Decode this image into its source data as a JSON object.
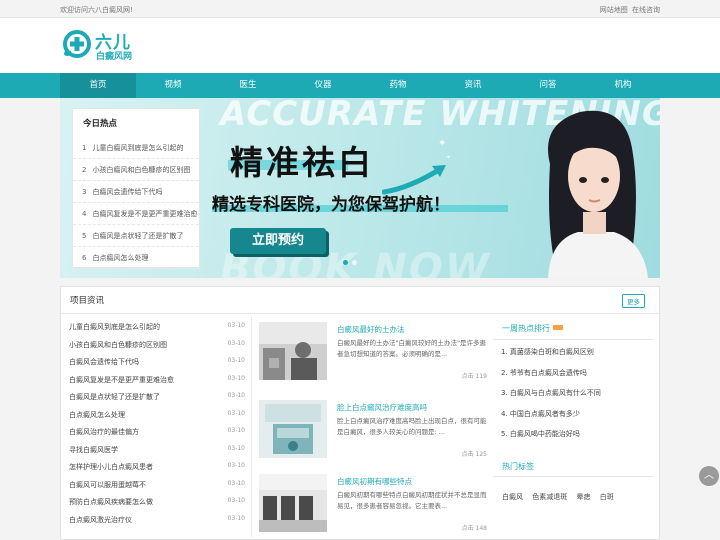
{
  "topbar": {
    "welcome": "欢迎访问六八白癜风网!",
    "links": [
      "网站地图",
      "在线咨询"
    ]
  },
  "logo": {
    "brand_main": "六儿",
    "brand_sub": "白癜风网"
  },
  "nav": {
    "items": [
      "首页",
      "视频",
      "医生",
      "仪器",
      "药物",
      "资讯",
      "问答",
      "机构"
    ],
    "active": "首页"
  },
  "banner": {
    "watermark_top": "ACCURATE WHITENING",
    "watermark_bottom": "BOOK NOW",
    "headline": "精准祛白",
    "subline": "精选专科医院，为您保驾护航！",
    "cta": "立即预约",
    "slide_count": 2,
    "active_slide": 1
  },
  "hot_today": {
    "title": "今日热点",
    "items": [
      "儿童白癜风到底是怎么引起的",
      "小孩白癜风和白色糠疹的区别图",
      "白癜风会遗传给下代吗",
      "白癜风复发是不是更严重更难治愈",
      "白癜风是点状轻了还是扩散了",
      "白点癜风怎么处理"
    ]
  },
  "section": {
    "title": "项目资讯",
    "more": "更多",
    "news": [
      {
        "title": "儿童白癜风到底是怎么引起的",
        "date": "03-10"
      },
      {
        "title": "小孩白癜风和白色糠疹的区别图",
        "date": "03-10"
      },
      {
        "title": "白癜风会遗传给下代吗",
        "date": "03-10"
      },
      {
        "title": "白癜风复发是不是更严重更难治愈",
        "date": "03-10"
      },
      {
        "title": "白癜风是点状轻了还是扩散了",
        "date": "03-10"
      },
      {
        "title": "白点癜风怎么处理",
        "date": "03-10"
      },
      {
        "title": "白癜风治疗的最佳偏方",
        "date": "03-10"
      },
      {
        "title": "寻找白癜风医学",
        "date": "03-10"
      },
      {
        "title": "怎样护理小儿白点癜风患者",
        "date": "03-10"
      },
      {
        "title": "白癜风可以服用蛋越莓不",
        "date": "03-10"
      },
      {
        "title": "预防白点癜风疾病要怎么做",
        "date": "03-10"
      },
      {
        "title": "白点癜风激光治疗仪",
        "date": "03-10"
      }
    ],
    "cards": [
      {
        "title": "白癜风最好的土办法",
        "desc": "白癜风最好的土办法\"白癜风较好的土办法\"是许多患者急切想知道的答案。必须明确的是...",
        "click_label": "点击",
        "clicks": "119"
      },
      {
        "title": "脸上白点癜风治疗难度高吗",
        "desc": "脸上白点癜风治疗难度高吗脸上出现白点，很有可能是白癜风，很多人较关心的问题是: ...",
        "click_label": "点击",
        "clicks": "125"
      },
      {
        "title": "白癜风初期有哪些特点",
        "desc": "白癜风初期有哪些特点白癜风初期症状并不总是显而易见，很多患者容易忽视。它主要表...",
        "click_label": "点击",
        "clicks": "148"
      }
    ]
  },
  "rank": {
    "title": "一周热点排行",
    "items": [
      "1. 真菌感染白斑和白癜风区别",
      "2. 爷爷有白点癜风会遗传吗",
      "3. 白癜风与白点癜风有什么不同",
      "4. 中国白点癜风者有多少",
      "5. 白癜风喝中药能治好吗"
    ]
  },
  "tags": {
    "title": "热门标签",
    "items": [
      "白癜风",
      "色素减退斑",
      "晕痣",
      "白斑"
    ]
  },
  "colors": {
    "brand": "#1eaab5",
    "nav_active": "#16909a",
    "badge": "#f4a340"
  },
  "icons": {
    "scroll_top": "chevron-up-icon",
    "logo": "medical-cross-logo-icon"
  }
}
